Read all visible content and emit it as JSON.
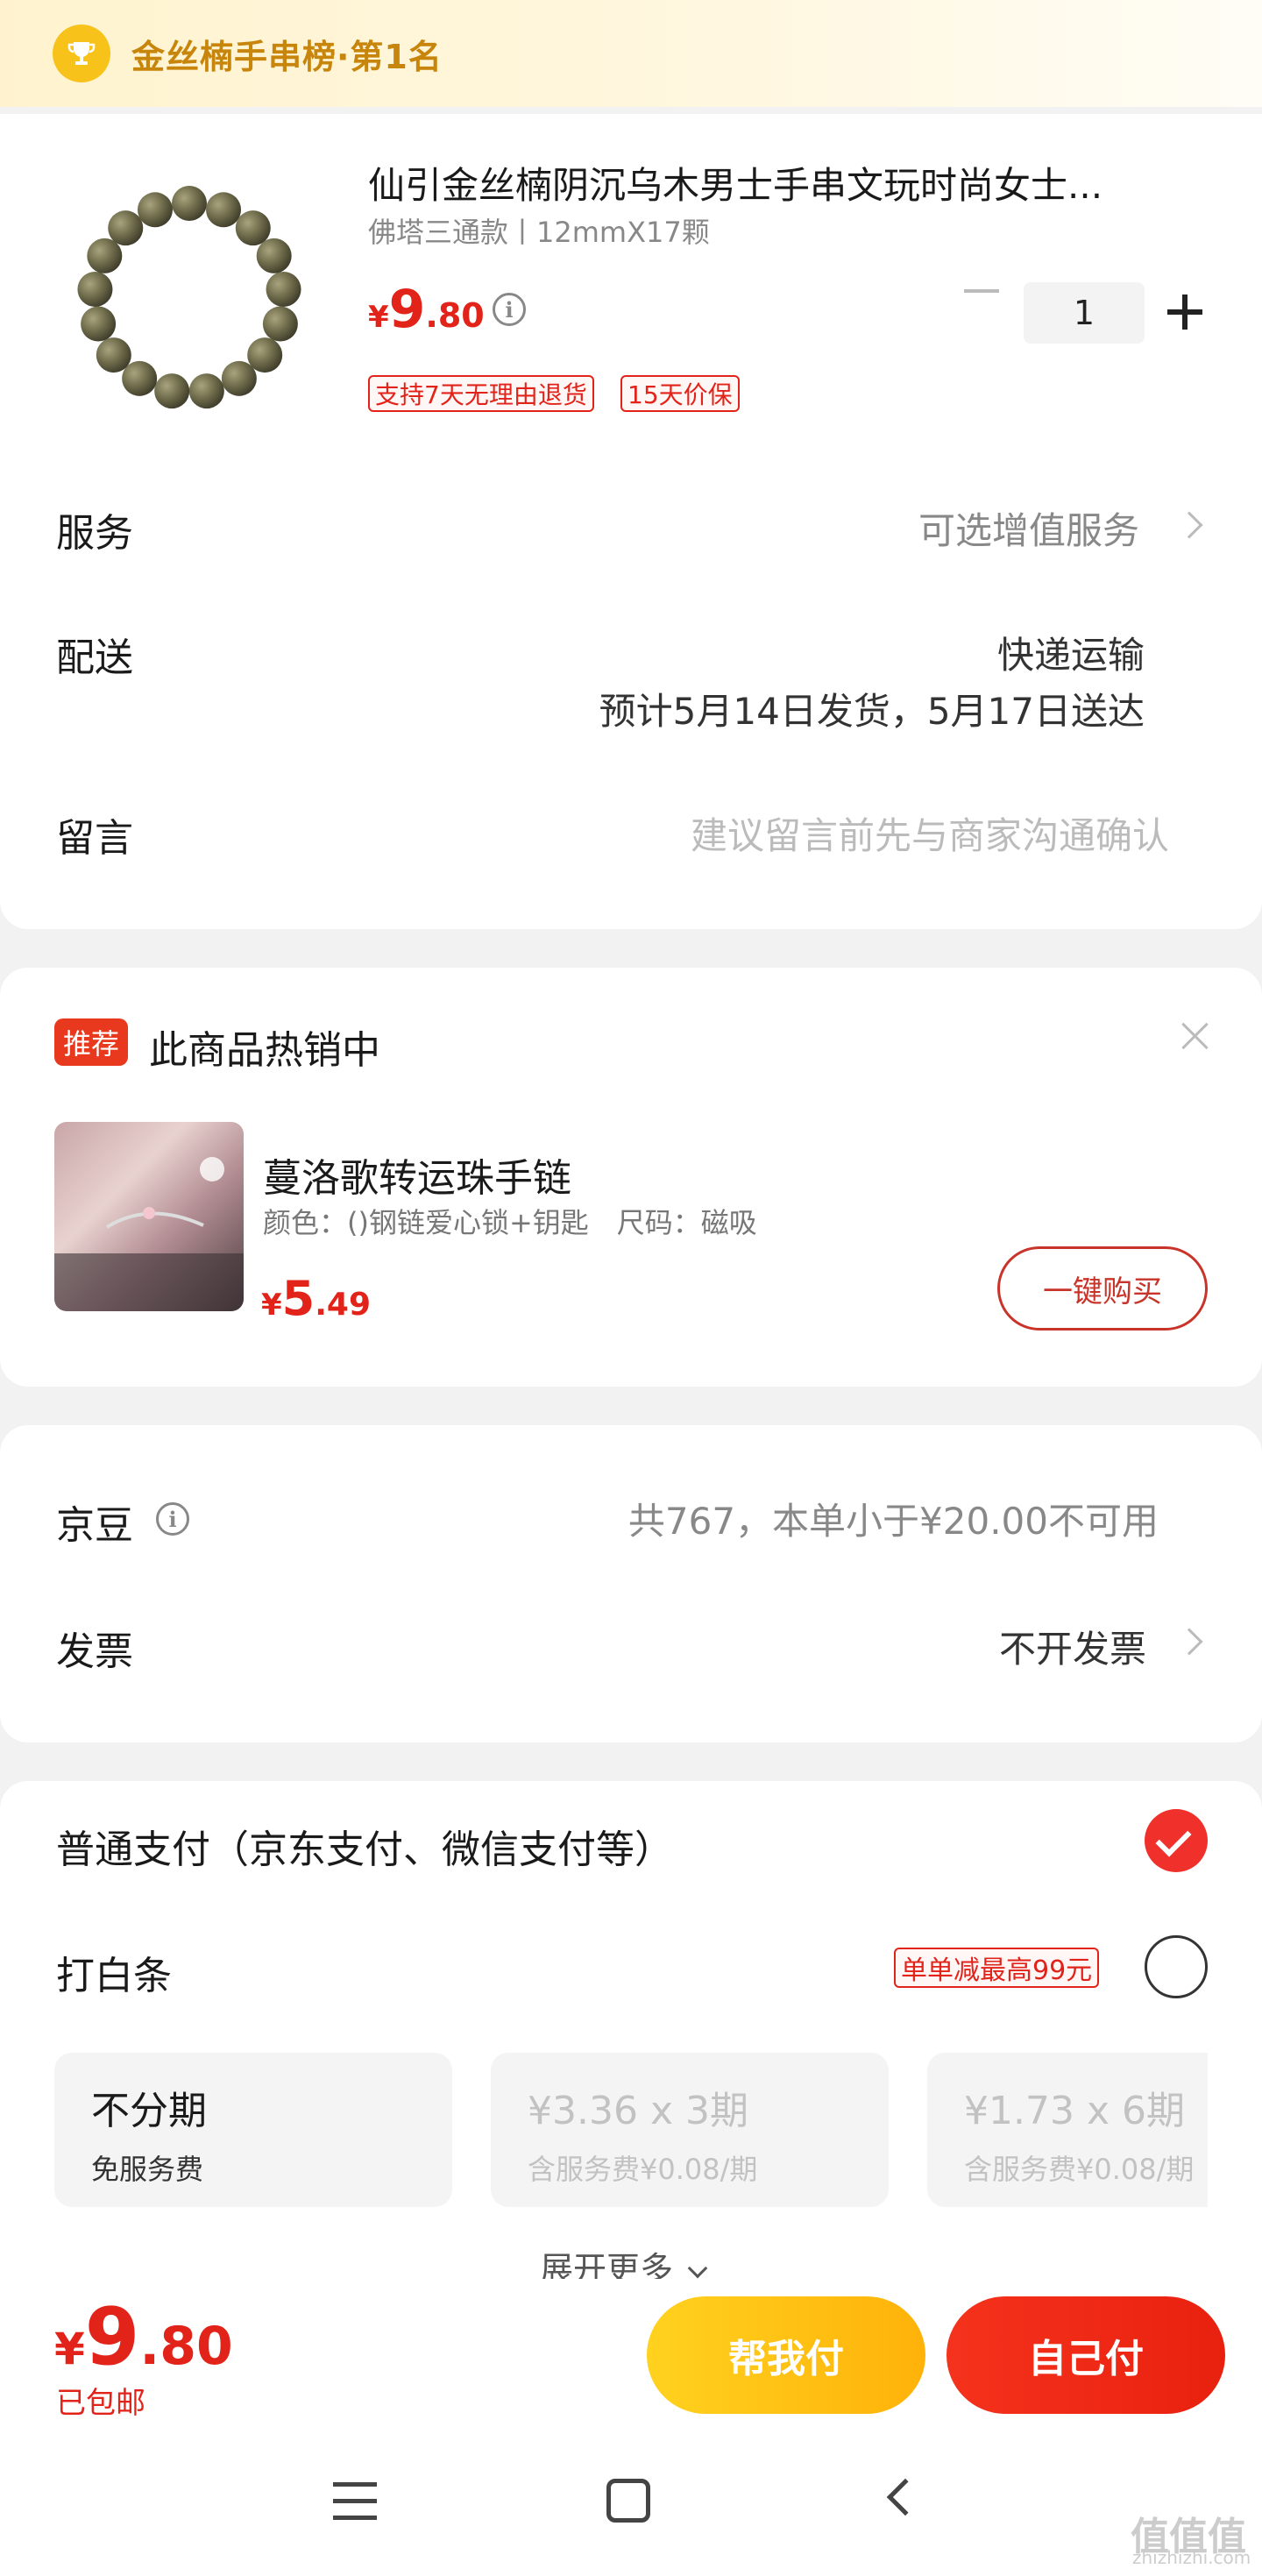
{
  "rank_banner": {
    "text": "金丝楠手串榜·第1名"
  },
  "product": {
    "title": "仙引金丝楠阴沉乌木男士手串文玩时尚女士...",
    "spec": "佛塔三通款丨12mmX17颗",
    "price_currency": "¥",
    "price_int": "9",
    "price_dec": ".80",
    "quantity": "1",
    "tags": [
      "支持7天无理由退货",
      "15天价保"
    ]
  },
  "service": {
    "label": "服务",
    "value": "可选增值服务"
  },
  "delivery": {
    "label": "配送",
    "method": "快递运输",
    "estimate": "预计5月14日发货，5月17日送达"
  },
  "message": {
    "label": "留言",
    "placeholder": "建议留言前先与商家沟通确认"
  },
  "recommend": {
    "badge": "推荐",
    "title": "此商品热销中",
    "item_name": "蔓洛歌转运珠手链",
    "item_spec": "颜色：()钢链爱心锁+钥匙　尺码：磁吸",
    "price_currency": "¥",
    "price_int": "5",
    "price_dec": ".49",
    "buy_label": "一键购买"
  },
  "jingdou": {
    "label": "京豆",
    "value": "共767，本单小于¥20.00不可用"
  },
  "invoice": {
    "label": "发票",
    "value": "不开发票"
  },
  "payment": {
    "normal_label": "普通支付（京东支付、微信支付等）",
    "baitiao_label": "打白条",
    "baitiao_promo": "单单减最高99元",
    "plans": [
      {
        "title": "不分期",
        "sub": "免服务费"
      },
      {
        "title": "¥3.36 x 3期",
        "sub": "含服务费¥0.08/期"
      },
      {
        "title": "¥1.73 x 6期",
        "sub": "含服务费¥0.08/期"
      }
    ],
    "expand_label": "展开更多"
  },
  "bottom": {
    "total_currency": "¥",
    "total_int": "9",
    "total_dec": ".80",
    "shipping": "已包邮",
    "help_pay": "帮我付",
    "self_pay": "自己付"
  },
  "watermark": {
    "main": "值值值",
    "sub": "zhizhizhi.com"
  },
  "colors": {
    "accent_red": "#e2231a",
    "gold": "#c8850b",
    "help_btn": "#ffc21a",
    "self_btn": "#f0301a"
  }
}
